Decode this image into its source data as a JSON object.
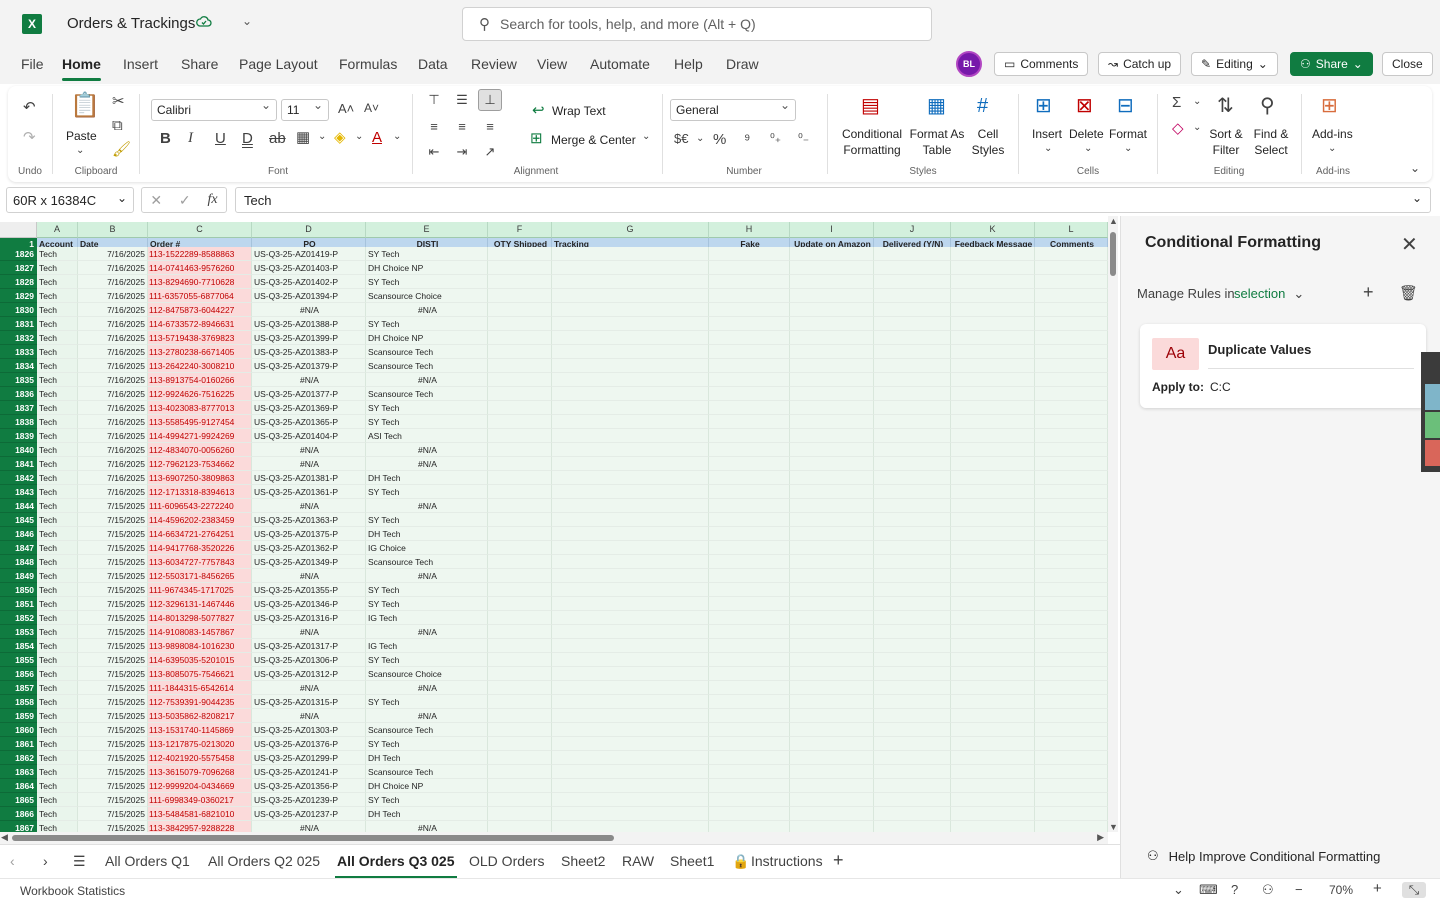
{
  "app": {
    "logo": "X",
    "title": "Orders & Trackings",
    "search_placeholder": "Search for tools, help, and more (Alt + Q)",
    "avatar_initials": "BL"
  },
  "menu": [
    "File",
    "Home",
    "Insert",
    "Share",
    "Page Layout",
    "Formulas",
    "Data",
    "Review",
    "View",
    "Automate",
    "Help",
    "Draw"
  ],
  "top_buttons": {
    "comments": "Comments",
    "catch_up": "Catch up",
    "editing": "Editing",
    "share": "Share",
    "close": "Close"
  },
  "ribbon": {
    "undo_label": "Undo",
    "paste_label": "Paste",
    "clipboard_label": "Clipboard",
    "font_name": "Calibri",
    "font_size": "11",
    "font_label": "Font",
    "wrap_text": "Wrap Text",
    "merge_center": "Merge & Center",
    "alignment_label": "Alignment",
    "number_format": "General",
    "number_label": "Number",
    "conditional_formatting": [
      "Conditional",
      "Formatting"
    ],
    "format_as_table": [
      "Format As",
      "Table"
    ],
    "cell_styles": [
      "Cell",
      "Styles"
    ],
    "styles_label": "Styles",
    "insert": "Insert",
    "delete": "Delete",
    "format": "Format",
    "cells_label": "Cells",
    "sort_filter": [
      "Sort &",
      "Filter"
    ],
    "find_select": [
      "Find &",
      "Select"
    ],
    "editing_label": "Editing",
    "addins": "Add-ins",
    "addins_label": "Add-ins"
  },
  "formula_bar": {
    "name_box": "60R x 16384C",
    "value": "Tech"
  },
  "columns": [
    {
      "letter": "A",
      "header": "Account"
    },
    {
      "letter": "B",
      "header": "Date"
    },
    {
      "letter": "C",
      "header": "Order #"
    },
    {
      "letter": "D",
      "header": "PO"
    },
    {
      "letter": "E",
      "header": "DISTI"
    },
    {
      "letter": "F",
      "header": "QTY Shipped"
    },
    {
      "letter": "G",
      "header": "Tracking"
    },
    {
      "letter": "H",
      "header": "Fake"
    },
    {
      "letter": "I",
      "header": "Update on Amazon"
    },
    {
      "letter": "J",
      "header": "Delivered (Y/N)"
    },
    {
      "letter": "K",
      "header": "Feedback Message"
    },
    {
      "letter": "L",
      "header": "Comments"
    }
  ],
  "header_row_number": "1",
  "rows": [
    {
      "n": "1826",
      "a": "Tech",
      "b": "7/16/2025",
      "c": "113-1522289-8588863",
      "d": "US-Q3-25-AZ01419-P",
      "e": "SY Tech"
    },
    {
      "n": "1827",
      "a": "Tech",
      "b": "7/16/2025",
      "c": "114-0741463-9576260",
      "d": "US-Q3-25-AZ01403-P",
      "e": "DH Choice NP"
    },
    {
      "n": "1828",
      "a": "Tech",
      "b": "7/16/2025",
      "c": "113-8294690-7710628",
      "d": "US-Q3-25-AZ01402-P",
      "e": "SY Tech"
    },
    {
      "n": "1829",
      "a": "Tech",
      "b": "7/16/2025",
      "c": "111-6357055-6877064",
      "d": "US-Q3-25-AZ01394-P",
      "e": "Scansource Choice"
    },
    {
      "n": "1830",
      "a": "Tech",
      "b": "7/16/2025",
      "c": "112-8475873-6044227",
      "d": "#N/A",
      "e": "#N/A"
    },
    {
      "n": "1831",
      "a": "Tech",
      "b": "7/16/2025",
      "c": "114-6733572-8946631",
      "d": "US-Q3-25-AZ01388-P",
      "e": "SY Tech"
    },
    {
      "n": "1832",
      "a": "Tech",
      "b": "7/16/2025",
      "c": "113-5719438-3769823",
      "d": "US-Q3-25-AZ01399-P",
      "e": "DH Choice NP"
    },
    {
      "n": "1833",
      "a": "Tech",
      "b": "7/16/2025",
      "c": "113-2780238-6671405",
      "d": "US-Q3-25-AZ01383-P",
      "e": "Scansource Tech"
    },
    {
      "n": "1834",
      "a": "Tech",
      "b": "7/16/2025",
      "c": "113-2642240-3008210",
      "d": "US-Q3-25-AZ01379-P",
      "e": "Scansource Tech"
    },
    {
      "n": "1835",
      "a": "Tech",
      "b": "7/16/2025",
      "c": "113-8913754-0160266",
      "d": "#N/A",
      "e": "#N/A"
    },
    {
      "n": "1836",
      "a": "Tech",
      "b": "7/16/2025",
      "c": "112-9924626-7516225",
      "d": "US-Q3-25-AZ01377-P",
      "e": "Scansource Tech"
    },
    {
      "n": "1837",
      "a": "Tech",
      "b": "7/16/2025",
      "c": "113-4023083-8777013",
      "d": "US-Q3-25-AZ01369-P",
      "e": "SY Tech"
    },
    {
      "n": "1838",
      "a": "Tech",
      "b": "7/16/2025",
      "c": "113-5585495-9127454",
      "d": "US-Q3-25-AZ01365-P",
      "e": "SY Tech"
    },
    {
      "n": "1839",
      "a": "Tech",
      "b": "7/16/2025",
      "c": "114-4994271-9924269",
      "d": "US-Q3-25-AZ01404-P",
      "e": "ASI Tech"
    },
    {
      "n": "1840",
      "a": "Tech",
      "b": "7/16/2025",
      "c": "112-4834070-0056260",
      "d": "#N/A",
      "e": "#N/A"
    },
    {
      "n": "1841",
      "a": "Tech",
      "b": "7/16/2025",
      "c": "112-7962123-7534662",
      "d": "#N/A",
      "e": "#N/A"
    },
    {
      "n": "1842",
      "a": "Tech",
      "b": "7/16/2025",
      "c": "113-6907250-3809863",
      "d": "US-Q3-25-AZ01381-P",
      "e": "DH Tech"
    },
    {
      "n": "1843",
      "a": "Tech",
      "b": "7/16/2025",
      "c": "112-1713318-8394613",
      "d": "US-Q3-25-AZ01361-P",
      "e": "SY Tech"
    },
    {
      "n": "1844",
      "a": "Tech",
      "b": "7/15/2025",
      "c": "111-6096543-2272240",
      "d": "#N/A",
      "e": "#N/A"
    },
    {
      "n": "1845",
      "a": "Tech",
      "b": "7/15/2025",
      "c": "114-4596202-2383459",
      "d": "US-Q3-25-AZ01363-P",
      "e": "SY Tech"
    },
    {
      "n": "1846",
      "a": "Tech",
      "b": "7/15/2025",
      "c": "114-6634721-2764251",
      "d": "US-Q3-25-AZ01375-P",
      "e": "DH Tech"
    },
    {
      "n": "1847",
      "a": "Tech",
      "b": "7/15/2025",
      "c": "114-9417768-3520226",
      "d": "US-Q3-25-AZ01362-P",
      "e": "IG Choice"
    },
    {
      "n": "1848",
      "a": "Tech",
      "b": "7/15/2025",
      "c": "113-6034727-7757843",
      "d": "US-Q3-25-AZ01349-P",
      "e": "Scansource Tech"
    },
    {
      "n": "1849",
      "a": "Tech",
      "b": "7/15/2025",
      "c": "112-5503171-8456265",
      "d": "#N/A",
      "e": "#N/A"
    },
    {
      "n": "1850",
      "a": "Tech",
      "b": "7/15/2025",
      "c": "111-9674345-1717025",
      "d": "US-Q3-25-AZ01355-P",
      "e": "SY Tech"
    },
    {
      "n": "1851",
      "a": "Tech",
      "b": "7/15/2025",
      "c": "112-3296131-1467446",
      "d": "US-Q3-25-AZ01346-P",
      "e": "SY Tech"
    },
    {
      "n": "1852",
      "a": "Tech",
      "b": "7/15/2025",
      "c": "114-8013298-5077827",
      "d": "US-Q3-25-AZ01316-P",
      "e": "IG Tech"
    },
    {
      "n": "1853",
      "a": "Tech",
      "b": "7/15/2025",
      "c": "114-9108083-1457867",
      "d": "#N/A",
      "e": "#N/A"
    },
    {
      "n": "1854",
      "a": "Tech",
      "b": "7/15/2025",
      "c": "113-9898084-1016230",
      "d": "US-Q3-25-AZ01317-P",
      "e": "IG Tech"
    },
    {
      "n": "1855",
      "a": "Tech",
      "b": "7/15/2025",
      "c": "114-6395035-5201015",
      "d": "US-Q3-25-AZ01306-P",
      "e": "SY Tech"
    },
    {
      "n": "1856",
      "a": "Tech",
      "b": "7/15/2025",
      "c": "113-8085075-7546621",
      "d": "US-Q3-25-AZ01312-P",
      "e": "Scansource Choice"
    },
    {
      "n": "1857",
      "a": "Tech",
      "b": "7/15/2025",
      "c": "111-1844315-6542614",
      "d": "#N/A",
      "e": "#N/A"
    },
    {
      "n": "1858",
      "a": "Tech",
      "b": "7/15/2025",
      "c": "112-7539391-9044235",
      "d": "US-Q3-25-AZ01315-P",
      "e": "SY Tech"
    },
    {
      "n": "1859",
      "a": "Tech",
      "b": "7/15/2025",
      "c": "113-5035862-8208217",
      "d": "#N/A",
      "e": "#N/A"
    },
    {
      "n": "1860",
      "a": "Tech",
      "b": "7/15/2025",
      "c": "113-1531740-1145869",
      "d": "US-Q3-25-AZ01303-P",
      "e": "Scansource Tech"
    },
    {
      "n": "1861",
      "a": "Tech",
      "b": "7/15/2025",
      "c": "113-1217875-0213020",
      "d": "US-Q3-25-AZ01376-P",
      "e": "SY Tech"
    },
    {
      "n": "1862",
      "a": "Tech",
      "b": "7/15/2025",
      "c": "112-4021920-5575458",
      "d": "US-Q3-25-AZ01299-P",
      "e": "DH Tech"
    },
    {
      "n": "1863",
      "a": "Tech",
      "b": "7/15/2025",
      "c": "113-3615079-7096268",
      "d": "US-Q3-25-AZ01241-P",
      "e": "Scansource Tech"
    },
    {
      "n": "1864",
      "a": "Tech",
      "b": "7/15/2025",
      "c": "112-9999204-0434669",
      "d": "US-Q3-25-AZ01356-P",
      "e": "DH Choice NP"
    },
    {
      "n": "1865",
      "a": "Tech",
      "b": "7/15/2025",
      "c": "111-6998349-0360217",
      "d": "US-Q3-25-AZ01239-P",
      "e": "SY Tech"
    },
    {
      "n": "1866",
      "a": "Tech",
      "b": "7/15/2025",
      "c": "113-5484581-6821010",
      "d": "US-Q3-25-AZ01237-P",
      "e": "DH Tech"
    },
    {
      "n": "1867",
      "a": "Tech",
      "b": "7/15/2025",
      "c": "113-3842957-9288228",
      "d": "#N/A",
      "e": "#N/A"
    }
  ],
  "sheets": [
    "All Orders Q1",
    "All Orders Q2 025",
    "All Orders Q3 025",
    "OLD Orders",
    "Sheet2",
    "RAW",
    "Sheet1",
    "Instructions"
  ],
  "active_sheet": "All Orders Q3 025",
  "panel": {
    "title": "Conditional Formatting",
    "manage_label": "Manage Rules in",
    "manage_scope": "selection",
    "rule": {
      "swatch": "Aa",
      "name": "Duplicate Values",
      "apply_label": "Apply to:",
      "apply_range": "C:C"
    },
    "help": "Help Improve Conditional Formatting"
  },
  "status": {
    "left": "Workbook Statistics",
    "zoom": "70%"
  },
  "colors": {
    "brand": "#107c41",
    "duplicate_fill": "#fbdada",
    "duplicate_text": "#c00000",
    "header_fill": "#bdd7ee"
  }
}
